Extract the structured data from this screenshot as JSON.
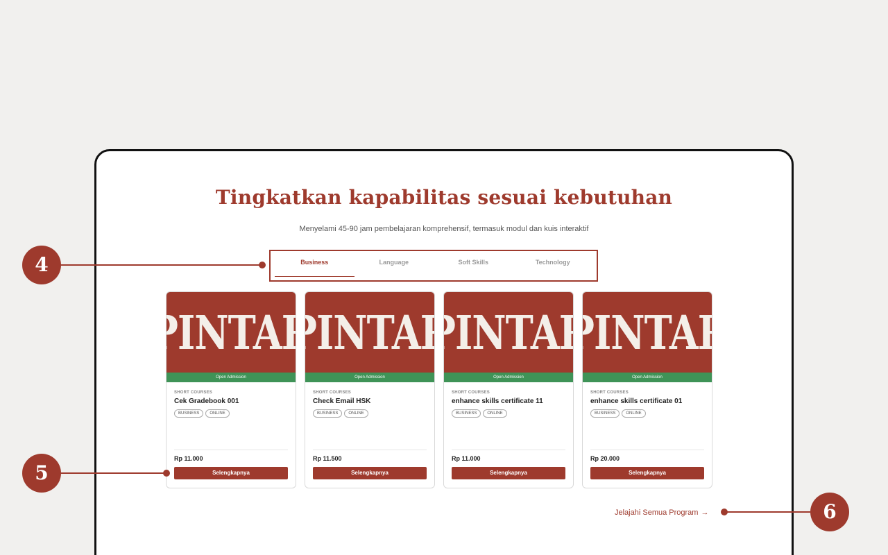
{
  "section": {
    "title": "Tingkatkan kapabilitas sesuai kebutuhan",
    "subtitle": "Menyelami 45-90 jam pembelajaran komprehensif, termasuk modul dan kuis interaktif"
  },
  "tabs": [
    {
      "label": "Business",
      "active": true
    },
    {
      "label": "Language",
      "active": false
    },
    {
      "label": "Soft Skills",
      "active": false
    },
    {
      "label": "Technology",
      "active": false
    }
  ],
  "cards": [
    {
      "logo": "PINTAR",
      "status": "Open Admission",
      "category": "SHORT COURSES",
      "title": "Cek Gradebook 001",
      "tags": [
        "BUSINESS",
        "ONLINE"
      ],
      "price": "Rp 11.000",
      "button": "Selengkapnya"
    },
    {
      "logo": "PINTAR",
      "status": "Open Admission",
      "category": "SHORT COURSES",
      "title": "Check Email HSK",
      "tags": [
        "BUSINESS",
        "ONLINE"
      ],
      "price": "Rp 11.500",
      "button": "Selengkapnya"
    },
    {
      "logo": "PINTAR",
      "status": "Open Admission",
      "category": "SHORT COURSES",
      "title": "enhance skills certificate 11",
      "tags": [
        "BUSINESS",
        "ONLINE"
      ],
      "price": "Rp 11.000",
      "button": "Selengkapnya"
    },
    {
      "logo": "PINTAR",
      "status": "Open Admission",
      "category": "SHORT COURSES",
      "title": "enhance skills certificate 01",
      "tags": [
        "BUSINESS",
        "ONLINE"
      ],
      "price": "Rp 20.000",
      "button": "Selengkapnya"
    }
  ],
  "explore": {
    "label": "Jelajahi Semua Program",
    "arrow": "→"
  },
  "markers": [
    "4",
    "5",
    "6"
  ],
  "colors": {
    "brand": "#9e3a2d",
    "status_green": "#3f9357",
    "background": "#f1f0ee"
  }
}
